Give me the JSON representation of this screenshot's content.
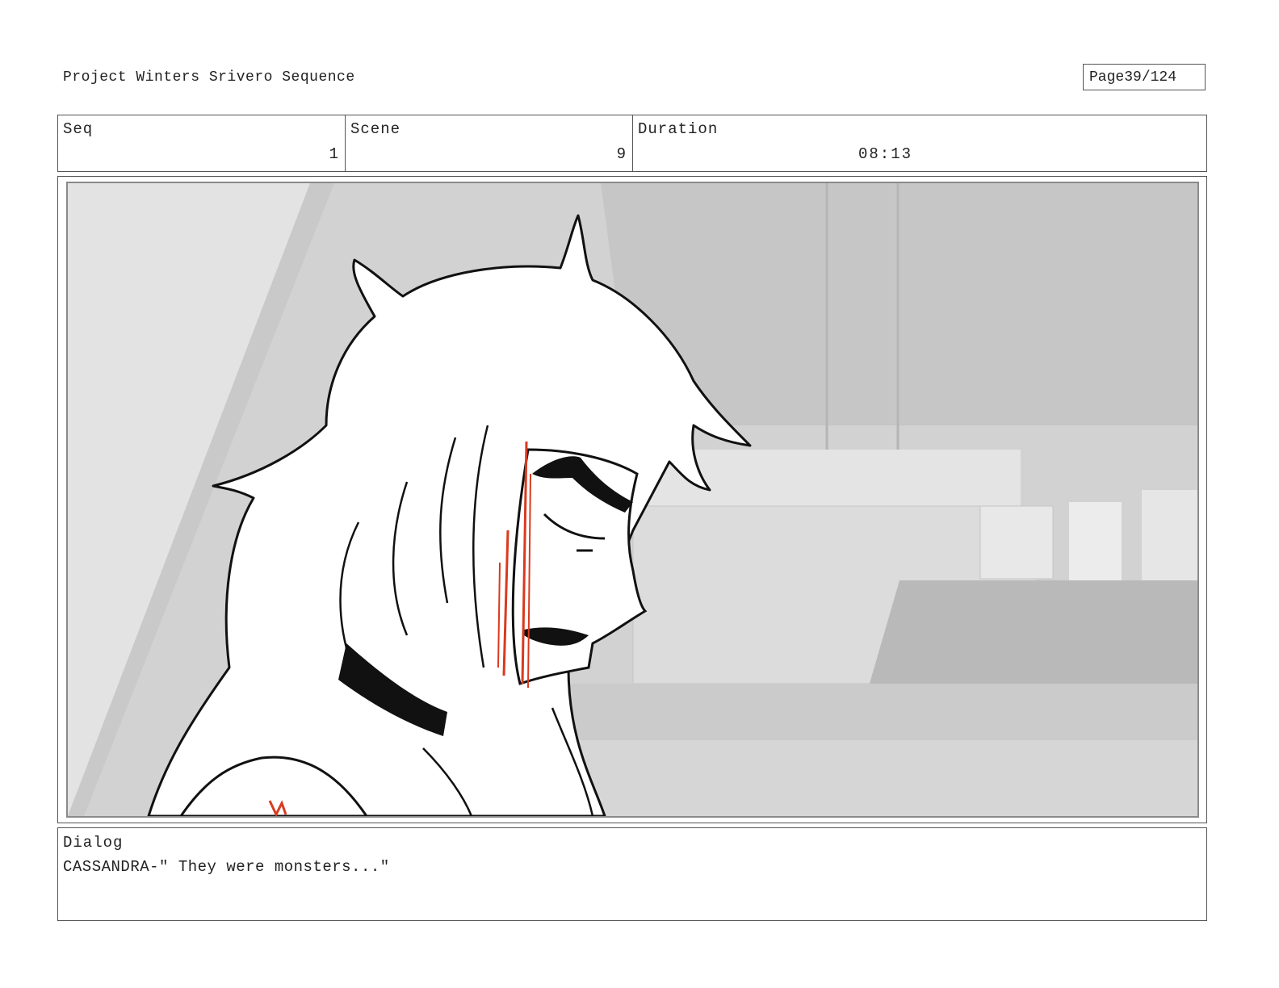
{
  "header": {
    "project_title": "Project Winters Srivero Sequence",
    "page_label": "Page",
    "page_number": "39/124"
  },
  "info": {
    "seq_label": "Seq",
    "seq_value": "1",
    "scene_label": "Scene",
    "scene_value": "9",
    "duration_label": "Duration",
    "duration_value": "08:13"
  },
  "panel": {
    "image_description_icon": "storyboard-sketch-image",
    "colors": {
      "background": "#d4d4d4",
      "line": "#111111",
      "accent_red": "#d93a1e"
    }
  },
  "dialog": {
    "label": "Dialog",
    "text": "CASSANDRA-\" They were monsters...\""
  }
}
